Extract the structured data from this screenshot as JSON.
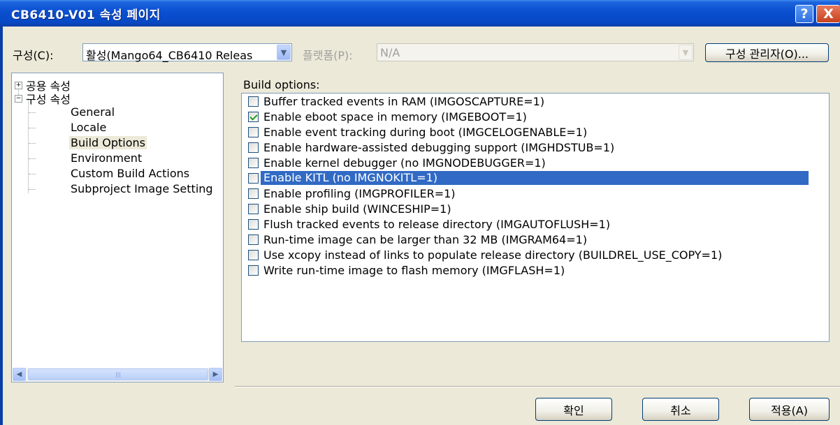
{
  "window": {
    "title": "CB6410-V01 속성 페이지",
    "help_label": "?",
    "close_label": "X"
  },
  "config": {
    "label": "구성(C):",
    "value": "활성(Mango64_CB6410 Releas",
    "platform_label": "플랫폼(P):",
    "platform_value": "N/A",
    "manager_button": "구성 관리자(O)..."
  },
  "tree": {
    "common_props": "공용 속성",
    "config_props": "구성 속성",
    "items": [
      {
        "label": "General"
      },
      {
        "label": "Locale"
      },
      {
        "label": "Build Options",
        "selected": true
      },
      {
        "label": "Environment"
      },
      {
        "label": "Custom Build Actions"
      },
      {
        "label": "Subproject Image Setting"
      }
    ],
    "scroll_thumb_grip": "|||"
  },
  "build_options": {
    "label": "Build options:",
    "items": [
      {
        "label": "Buffer tracked events in RAM (IMGOSCAPTURE=1)",
        "checked": false,
        "highlighted": false
      },
      {
        "label": "Enable eboot space in memory (IMGEBOOT=1)",
        "checked": true,
        "highlighted": false
      },
      {
        "label": "Enable event tracking during boot (IMGCELOGENABLE=1)",
        "checked": false,
        "highlighted": false
      },
      {
        "label": "Enable hardware-assisted debugging support (IMGHDSTUB=1)",
        "checked": false,
        "highlighted": false
      },
      {
        "label": "Enable kernel debugger (no IMGNODEBUGGER=1)",
        "checked": false,
        "highlighted": false
      },
      {
        "label": "Enable KITL (no IMGNOKITL=1)",
        "checked": false,
        "highlighted": true
      },
      {
        "label": "Enable profiling (IMGPROFILER=1)",
        "checked": false,
        "highlighted": false
      },
      {
        "label": "Enable ship build (WINCESHIP=1)",
        "checked": false,
        "highlighted": false
      },
      {
        "label": "Flush tracked events to release directory (IMGAUTOFLUSH=1)",
        "checked": false,
        "highlighted": false
      },
      {
        "label": "Run-time image can be larger than 32 MB (IMGRAM64=1)",
        "checked": false,
        "highlighted": false
      },
      {
        "label": "Use xcopy instead of links to populate release directory (BUILDREL_USE_COPY=1)",
        "checked": false,
        "highlighted": false
      },
      {
        "label": "Write run-time image to flash memory (IMGFLASH=1)",
        "checked": false,
        "highlighted": false
      }
    ]
  },
  "buttons": {
    "ok": "확인",
    "cancel": "취소",
    "apply": "적용(A)"
  },
  "colors": {
    "titlebar": "#0a4fd0",
    "dialog_bg": "#ece9d8",
    "selection": "#316ac5"
  }
}
